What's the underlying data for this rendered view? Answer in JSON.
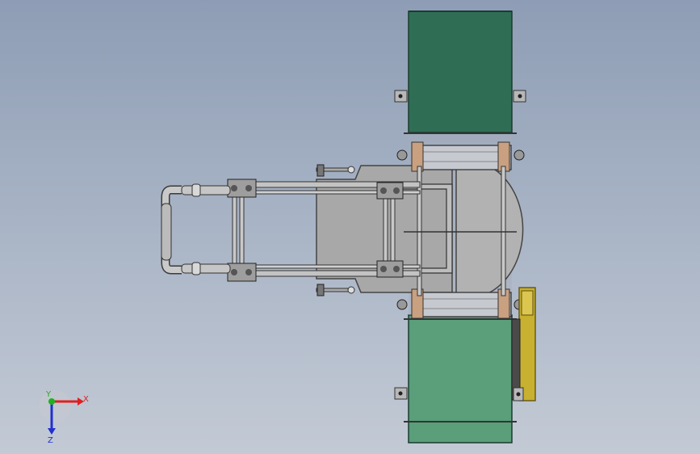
{
  "viewport": {
    "background_top": "#8e9db5",
    "background_bottom": "#c3cad5"
  },
  "model": {
    "belt_top_color": "#2f6e55",
    "belt_bottom_color": "#5a9e7a",
    "plate_color": "#a8a8a8",
    "gear_housing_color": "#c8b030"
  },
  "triad": {
    "x_label": "X",
    "y_label": "Y",
    "z_label": "Z",
    "x_color": "#e02020",
    "y_color": "#20b020",
    "z_color": "#2030d0"
  }
}
